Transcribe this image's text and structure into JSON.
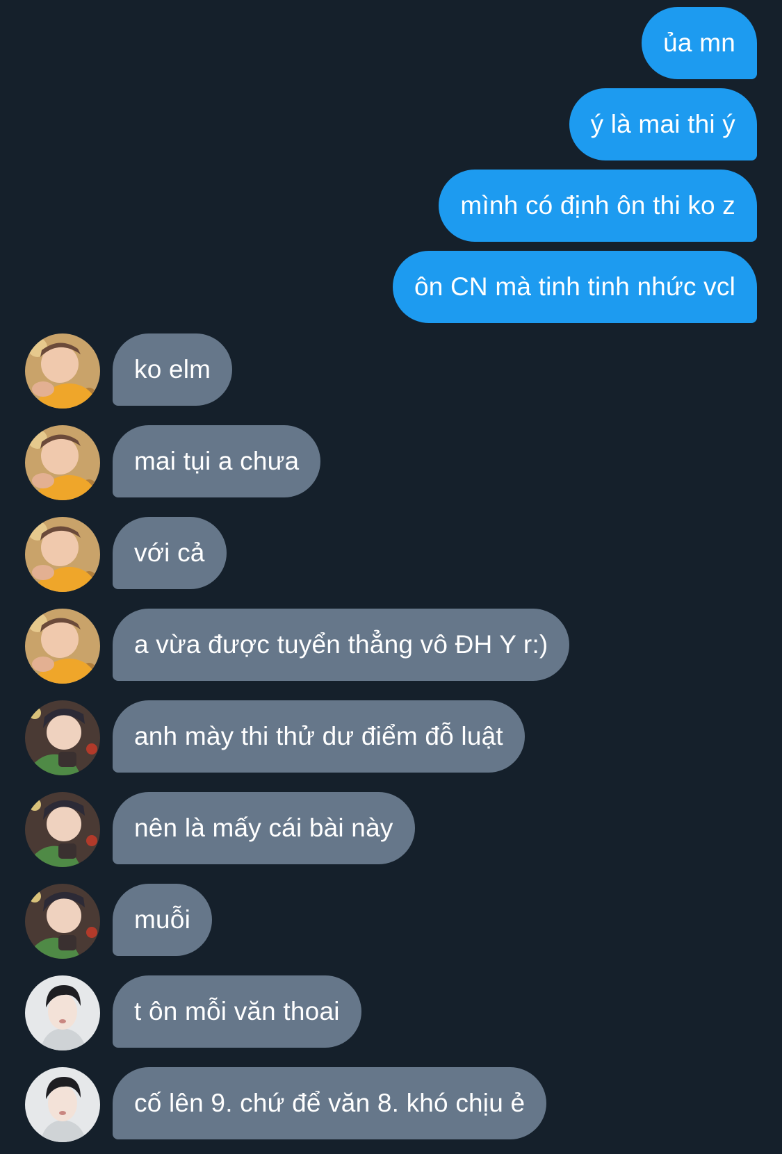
{
  "theme": {
    "background": "#15202b",
    "sent_bubble": "#1d9bf0",
    "received_bubble": "#66778a",
    "text": "#ffffff"
  },
  "messages": [
    {
      "direction": "sent",
      "text": "ủa mn"
    },
    {
      "direction": "sent",
      "text": "ý là mai thi ý"
    },
    {
      "direction": "sent",
      "text": "mình có định ôn thi ko z"
    },
    {
      "direction": "sent",
      "text": "ôn CN mà tinh tinh nhức vcl"
    },
    {
      "direction": "received",
      "avatar": "avatar-orange-sweater",
      "text": "ko elm"
    },
    {
      "direction": "received",
      "avatar": "avatar-orange-sweater",
      "text": "mai tụi a chưa"
    },
    {
      "direction": "received",
      "avatar": "avatar-orange-sweater",
      "text": "với cả"
    },
    {
      "direction": "received",
      "avatar": "avatar-orange-sweater",
      "text": "a vừa được tuyển thẳng vô ĐH Y r:)"
    },
    {
      "direction": "received",
      "avatar": "avatar-green-sweater",
      "text": "anh mày thi thử dư điểm đỗ luật"
    },
    {
      "direction": "received",
      "avatar": "avatar-green-sweater",
      "text": "nên là mấy cái bài này"
    },
    {
      "direction": "received",
      "avatar": "avatar-green-sweater",
      "text": "muỗi"
    },
    {
      "direction": "received",
      "avatar": "avatar-portrait-light",
      "text": "t ôn mỗi văn thoai"
    },
    {
      "direction": "received",
      "avatar": "avatar-portrait-light",
      "text": "cố lên 9. chứ để văn 8. khó chịu ẻ"
    }
  ]
}
